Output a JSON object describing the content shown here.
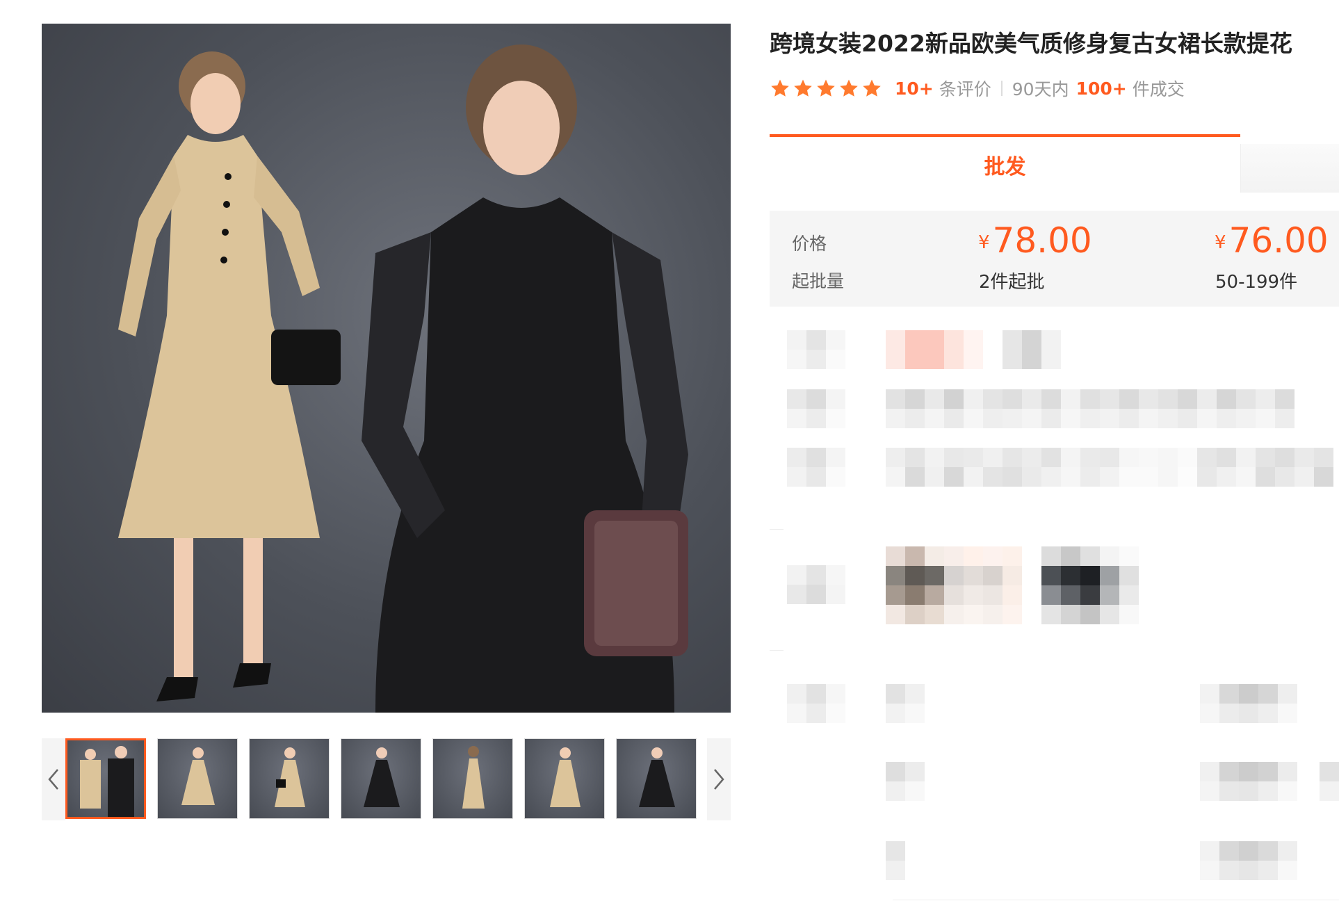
{
  "gallery": {
    "prev_icon": "chevron-left-icon",
    "next_icon": "chevron-right-icon",
    "thumbnails": [
      {
        "variant": "duo"
      },
      {
        "variant": "beige"
      },
      {
        "variant": "beige"
      },
      {
        "variant": "black"
      },
      {
        "variant": "beige-back"
      },
      {
        "variant": "beige"
      },
      {
        "variant": "black"
      }
    ],
    "active_index": 0
  },
  "product": {
    "title": "跨境女装2022新品欧美气质修身复古女裙长款提花",
    "rating": {
      "stars": 5,
      "review_count": "10+",
      "review_label": "条评价",
      "period_label": "90天内",
      "sales_count": "100+",
      "sales_label": "件成交"
    },
    "tab_label": "批发",
    "pricing": {
      "price_label": "价格",
      "moq_label": "起批量",
      "currency": "¥",
      "tiers": [
        {
          "price": "78.00",
          "qty": "2件起批"
        },
        {
          "price": "76.00",
          "qty": "50-199件"
        }
      ]
    }
  },
  "colors": {
    "accent": "#ff5a1f",
    "star": "#ff7a2e",
    "beige_dress": "#dcc49a",
    "black_dress": "#1b1b1d",
    "backdrop": "#555961"
  }
}
